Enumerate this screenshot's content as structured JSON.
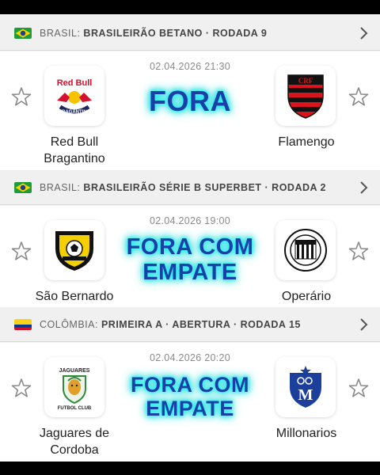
{
  "sections": [
    {
      "league": {
        "country": "BRASIL:",
        "competition": "BRASILEIRÃO BETANO · RODADA 9",
        "flag": "brazil-flag"
      },
      "match": {
        "datetime": "02.04.2026 21:30",
        "home": {
          "name_line1": "Red Bull",
          "name_line2": "Bragantino",
          "logo": "red-bull-bragantino-logo"
        },
        "away": {
          "name_line1": "Flamengo",
          "name_line2": "",
          "logo": "flamengo-logo"
        },
        "overlay_line1": "FORA",
        "overlay_line2": ""
      }
    },
    {
      "league": {
        "country": "BRASIL:",
        "competition": "BRASILEIRÃO SÉRIE B SUPERBET · RODADA 2",
        "flag": "brazil-flag"
      },
      "match": {
        "datetime": "02.04.2026 19:00",
        "home": {
          "name_line1": "São Bernardo",
          "name_line2": "",
          "logo": "sao-bernardo-logo"
        },
        "away": {
          "name_line1": "Operário",
          "name_line2": "",
          "logo": "operario-logo"
        },
        "overlay_line1": "FORA COM",
        "overlay_line2": "EMPATE"
      }
    },
    {
      "league": {
        "country": "COLÔMBIA:",
        "competition": "PRIMEIRA A · ABERTURA · RODADA 15",
        "flag": "colombia-flag"
      },
      "match": {
        "datetime": "02.04.2026 20:20",
        "home": {
          "name_line1": "Jaguares de",
          "name_line2": "Cordoba",
          "logo": "jaguares-logo"
        },
        "away": {
          "name_line1": "Millonarios",
          "name_line2": "",
          "logo": "millonarios-logo"
        },
        "overlay_line1": "FORA COM",
        "overlay_line2": "EMPATE"
      }
    }
  ],
  "logo_text": {
    "bragantino": "Red Bull",
    "bragantino_sub": "BRAGANTINO",
    "jaguares_top": "JAGUARES",
    "jaguares_bottom": "FUTBOL CLUB",
    "millonarios": "M"
  },
  "colors": {
    "overlay_text": "#1a40a8",
    "overlay_glow": "#22e6ee",
    "flamengo_red": "#d8141c",
    "millonarios_blue": "#1c3f9c",
    "sao_bernardo_yellow": "#f4d000"
  }
}
